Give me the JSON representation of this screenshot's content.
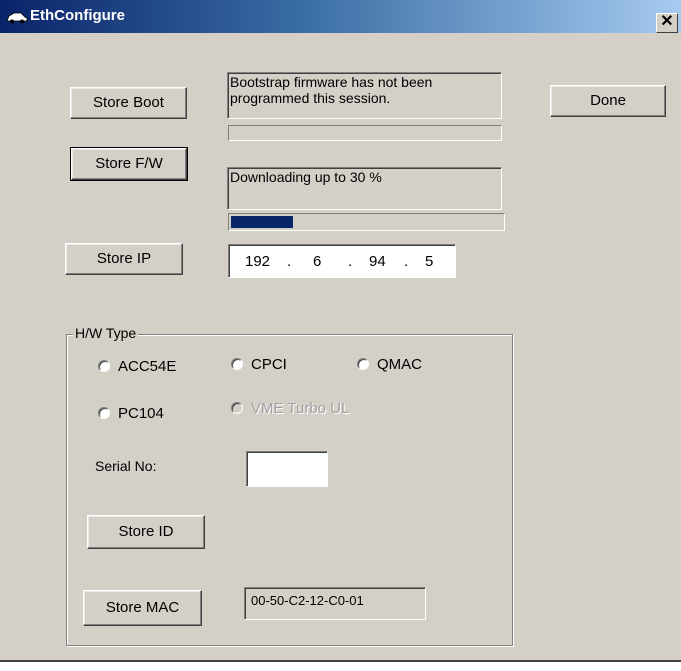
{
  "window": {
    "title": "EthConfigure",
    "close_glyph": "✕"
  },
  "buttons": {
    "store_boot": "Store Boot",
    "store_fw": "Store F/W",
    "store_ip": "Store IP",
    "done": "Done",
    "store_id": "Store ID",
    "store_mac": "Store MAC"
  },
  "boot_status": "Bootstrap firmware has not been programmed this session.",
  "boot_progress": 0,
  "fw_status": "Downloading up to 30 %",
  "fw_progress": 0.23,
  "ip": {
    "octet1": "192",
    "octet2": "6",
    "octet3": "94",
    "octet4": "5",
    "dot": "."
  },
  "hw_type": {
    "label": "H/W Type",
    "options": {
      "acc54e": "ACC54E",
      "cpci": "CPCI",
      "qmac": "QMAC",
      "pc104": "PC104",
      "vme": "VME Turbo UL"
    },
    "serial_label": "Serial No:",
    "serial_value": "",
    "mac_value": "00-50-C2-12-C0-01"
  },
  "icons": {
    "app": "car-icon"
  },
  "colors": {
    "dialog_bg": "#d4d0c8",
    "title_start": "#0a246a",
    "title_end": "#a6caf0",
    "progress_fill": "#0a246a"
  }
}
